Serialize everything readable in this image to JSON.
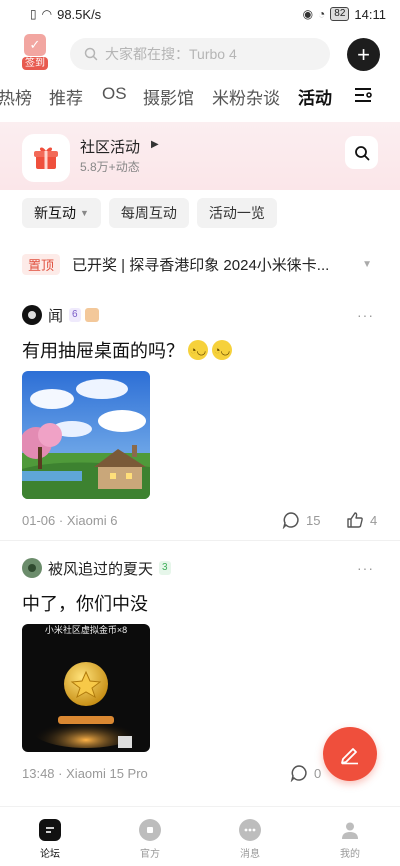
{
  "status_bar": {
    "network_speed": "98.5K/s",
    "battery": "82",
    "time": "14:11"
  },
  "header": {
    "checkin_label": "签到",
    "search_placeholder": "大家都在搜：Turbo 4",
    "add_label": "+"
  },
  "tabs": [
    {
      "label": "热榜",
      "active": false
    },
    {
      "label": "推荐",
      "active": false
    },
    {
      "label": "OS",
      "active": false
    },
    {
      "label": "摄影馆",
      "active": false
    },
    {
      "label": "米粉杂谈",
      "active": false
    },
    {
      "label": "活动",
      "active": true
    }
  ],
  "banner": {
    "title": "社区活动",
    "subtitle": "5.8万+动态"
  },
  "filters": [
    {
      "label": "新互动",
      "active": true
    },
    {
      "label": "每周互动",
      "active": false
    },
    {
      "label": "活动一览",
      "active": false
    }
  ],
  "pinned": {
    "tag": "置顶",
    "text": "已开奖 | 探寻香港印象 2024小米徕卡..."
  },
  "posts": [
    {
      "username": "闻",
      "level": "6",
      "title": "有用抽屉桌面的吗？",
      "date": "01-06",
      "device": "Xiaomi 6",
      "meta_separator": "·",
      "comments": "15",
      "likes": "4"
    },
    {
      "username": "被风追过的夏天",
      "level": "3",
      "title": "中了，你们中没",
      "image_text": "小米社区虚拟金币×8",
      "date": "13:48",
      "device": "Xiaomi 15 Pro",
      "meta_separator": "·",
      "comments": "0"
    }
  ],
  "bottom_nav": [
    {
      "label": "论坛",
      "active": true
    },
    {
      "label": "官方",
      "active": false
    },
    {
      "label": "消息",
      "active": false
    },
    {
      "label": "我的",
      "active": false
    }
  ],
  "colors": {
    "accent": "#ef4f3c",
    "banner_bg": "#fbeef0"
  }
}
